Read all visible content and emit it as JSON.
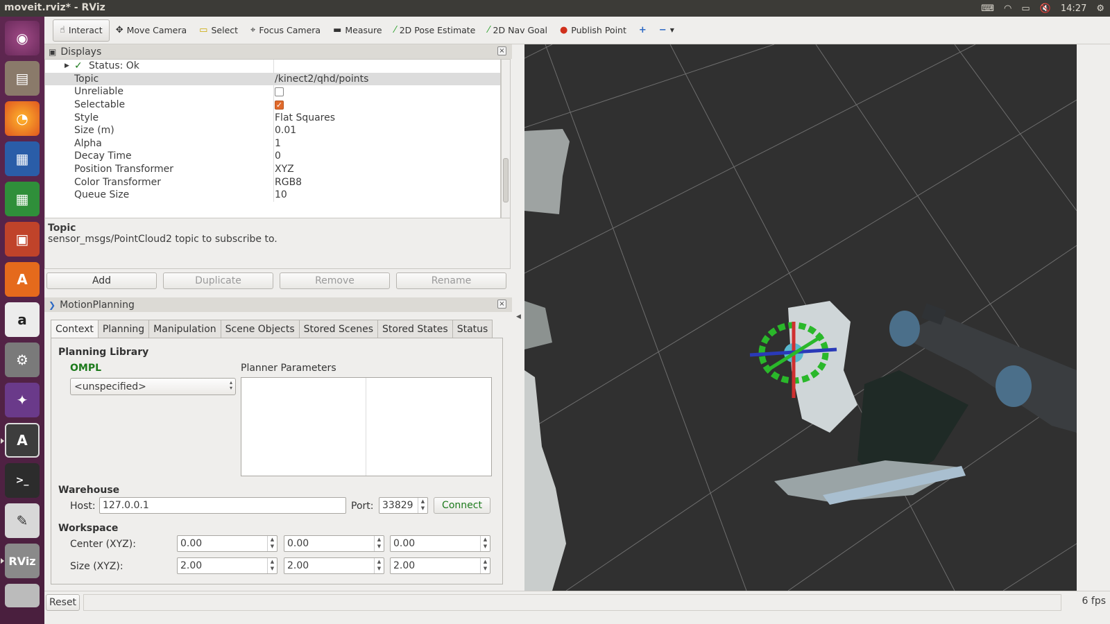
{
  "window": {
    "title": "moveit.rviz* - RViz"
  },
  "tray": {
    "keyboard_icon": "keyboard-icon",
    "wifi_icon": "wifi-icon",
    "battery_icon": "battery-icon",
    "sound_icon": "sound-muted-icon",
    "time": "14:27",
    "gear_icon": "gear-icon"
  },
  "launcher": {
    "items": [
      "ubuntu-dash",
      "files",
      "firefox",
      "writer",
      "calc",
      "impress",
      "software-center",
      "amazon",
      "system-settings",
      "app-icon",
      "software-updater",
      "terminal",
      "text-editor",
      "rviz",
      "drive"
    ]
  },
  "toolbar": {
    "interact": "Interact",
    "move_camera": "Move Camera",
    "select": "Select",
    "focus_camera": "Focus Camera",
    "measure": "Measure",
    "pose_estimate": "2D Pose Estimate",
    "nav_goal": "2D Nav Goal",
    "publish_point": "Publish Point"
  },
  "displays": {
    "title": "Displays",
    "status": "Status: Ok",
    "rows": [
      {
        "key": "Topic",
        "value": "/kinect2/qhd/points"
      },
      {
        "key": "Unreliable",
        "value": ""
      },
      {
        "key": "Selectable",
        "value": ""
      },
      {
        "key": "Style",
        "value": "Flat Squares"
      },
      {
        "key": "Size (m)",
        "value": "0.01"
      },
      {
        "key": "Alpha",
        "value": "1"
      },
      {
        "key": "Decay Time",
        "value": "0"
      },
      {
        "key": "Position Transformer",
        "value": "XYZ"
      },
      {
        "key": "Color Transformer",
        "value": "RGB8"
      },
      {
        "key": "Queue Size",
        "value": "10"
      }
    ],
    "unreliable_checked": false,
    "selectable_checked": true
  },
  "help": {
    "title": "Topic",
    "text": "sensor_msgs/PointCloud2 topic to subscribe to."
  },
  "buttons": {
    "add": "Add",
    "duplicate": "Duplicate",
    "remove": "Remove",
    "rename": "Rename"
  },
  "motion": {
    "title": "MotionPlanning",
    "tabs": [
      "Context",
      "Planning",
      "Manipulation",
      "Scene Objects",
      "Stored Scenes",
      "Stored States",
      "Status"
    ],
    "planning_library": "Planning Library",
    "library_name": "OMPL",
    "planner_value": "<unspecified>",
    "planner_params": "Planner Parameters",
    "warehouse": "Warehouse",
    "host_label": "Host:",
    "host": "127.0.0.1",
    "port_label": "Port:",
    "port": "33829",
    "connect": "Connect",
    "workspace": "Workspace",
    "center_label": "Center (XYZ):",
    "size_label": "Size (XYZ):",
    "center": [
      "0.00",
      "0.00",
      "0.00"
    ],
    "size": [
      "2.00",
      "2.00",
      "2.00"
    ]
  },
  "statusbar": {
    "reset": "Reset",
    "fps": "6 fps"
  }
}
